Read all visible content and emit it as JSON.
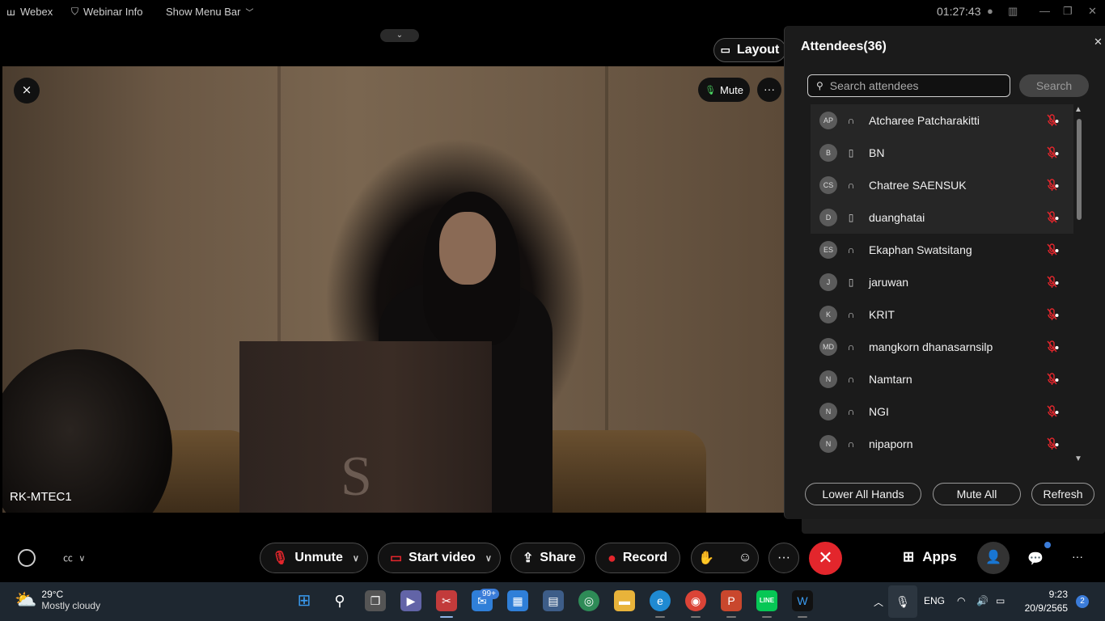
{
  "topbar": {
    "app_name": "Webex",
    "webinar_info": "Webinar Info",
    "show_menu_bar": "Show Menu Bar",
    "clock": "01:27:43"
  },
  "stage": {
    "layout_label": "Layout",
    "mute_label": "Mute",
    "participant_name": "RK-MTEC1"
  },
  "attendees": {
    "title": "Attendees(36)",
    "search_placeholder": "Search attendees",
    "search_button": "Search",
    "list": [
      {
        "initials": "AP",
        "name": "Atcharee Patcharakitti",
        "device": "headset",
        "highlight": true
      },
      {
        "initials": "B",
        "name": "BN",
        "device": "phone",
        "highlight": true
      },
      {
        "initials": "CS",
        "name": "Chatree SAENSUK",
        "device": "headset",
        "highlight": true
      },
      {
        "initials": "D",
        "name": "duanghatai",
        "device": "phone",
        "highlight": true
      },
      {
        "initials": "ES",
        "name": "Ekaphan Swatsitang",
        "device": "headset",
        "highlight": false
      },
      {
        "initials": "J",
        "name": "jaruwan",
        "device": "phone",
        "highlight": false
      },
      {
        "initials": "K",
        "name": "KRIT",
        "device": "headset",
        "highlight": false
      },
      {
        "initials": "MD",
        "name": "mangkorn dhanasarnsilp",
        "device": "headset",
        "highlight": false
      },
      {
        "initials": "N",
        "name": "Namtarn",
        "device": "headset",
        "highlight": false
      },
      {
        "initials": "N",
        "name": "NGI",
        "device": "headset",
        "highlight": false
      },
      {
        "initials": "N",
        "name": "nipaporn",
        "device": "headset",
        "highlight": false
      }
    ],
    "lower_all_hands": "Lower All Hands",
    "mute_all": "Mute All",
    "refresh": "Refresh"
  },
  "toolbar": {
    "unmute": "Unmute",
    "start_video": "Start video",
    "share": "Share",
    "record": "Record",
    "apps": "Apps"
  },
  "taskbar": {
    "temperature": "29°C",
    "weather": "Mostly cloudy",
    "mail_badge": "99+",
    "language": "ENG",
    "time": "9:23",
    "date": "20/9/2565",
    "notifications": "2"
  },
  "colors": {
    "end_call": "#e3262c",
    "panel_bg": "#1b1b1b",
    "taskbar_bg": "#1e2730",
    "accent_blue": "#3b7cd9"
  }
}
